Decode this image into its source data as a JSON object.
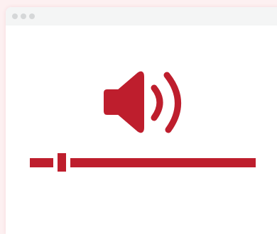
{
  "window": {
    "title_dots": [
      "close",
      "minimize",
      "maximize"
    ]
  },
  "icon": {
    "name": "speaker-volume-icon",
    "color": "#be1e2d"
  },
  "volume": {
    "level": 0.14
  },
  "colors": {
    "accent": "#be1e2d",
    "background": "#fdf0f1",
    "window": "#ffffff",
    "titlebar": "#f4f5f5",
    "dots": "#d5d7d8"
  }
}
